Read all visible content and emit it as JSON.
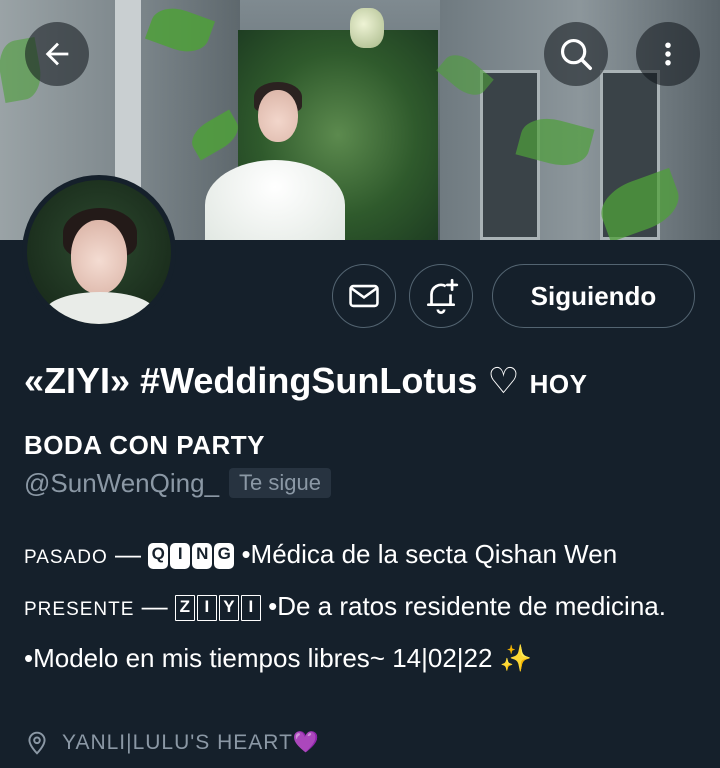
{
  "header": {
    "back_icon": "arrow-left-icon",
    "search_icon": "search-icon",
    "more_icon": "more-vertical-icon"
  },
  "profile": {
    "display_name_prefix": "«ZIYI» #WeddingSunLotus ♡ ",
    "display_name_caps_1": "HOY",
    "display_name_caps_2": "BODA CON PARTY",
    "handle": "@SunWenQing_",
    "follows_you_label": "Te sigue",
    "bio": {
      "past_label": "PASADO",
      "dash": " — ",
      "qing_letters": [
        "Q",
        "I",
        "N",
        "G"
      ],
      "text_1": " •Médica de la secta Qishan Wen ",
      "present_label": "PRESENTE",
      "ziyi_letters": [
        "Z",
        "I",
        "Y",
        "I"
      ],
      "text_2": " •De a ratos residente de medicina. •Modelo en mis tiempos libres~  14|02|22 ✨"
    },
    "location": "YANLI|LULU'S HEART💜"
  },
  "actions": {
    "message_icon": "mail-icon",
    "notify_icon": "bell-plus-icon",
    "following_label": "Siguiendo"
  },
  "colors": {
    "background": "#15202b",
    "muted_text": "#8b98a5",
    "border": "#536471"
  }
}
